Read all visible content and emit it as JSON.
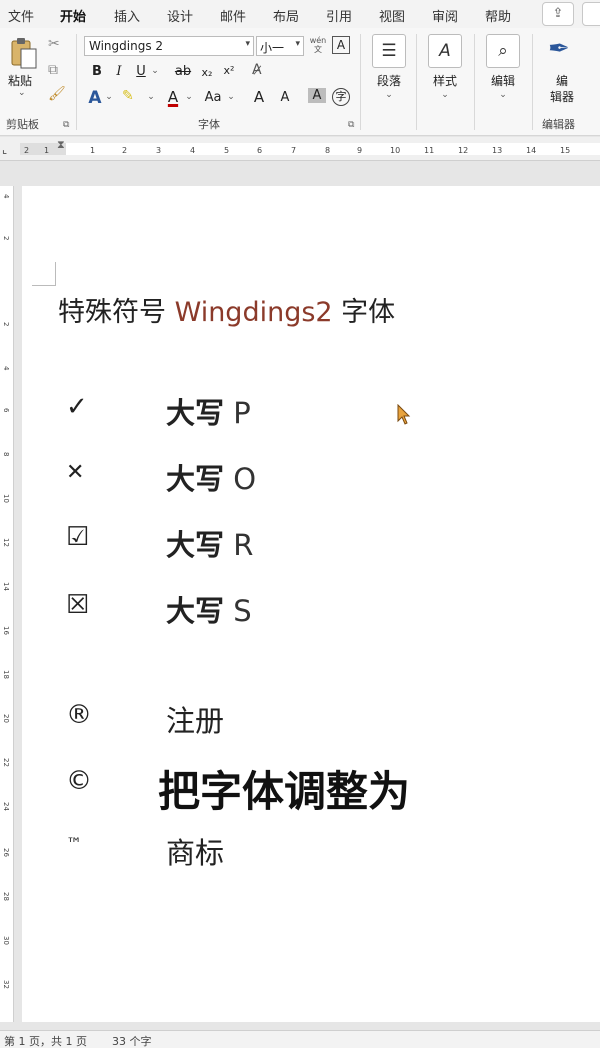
{
  "menu": {
    "tabs": [
      {
        "label": "文件"
      },
      {
        "label": "开始"
      },
      {
        "label": "插入"
      },
      {
        "label": "设计"
      },
      {
        "label": "邮件"
      },
      {
        "label": "布局"
      },
      {
        "label": "引用"
      },
      {
        "label": "视图"
      },
      {
        "label": "审阅"
      },
      {
        "label": "帮助"
      }
    ],
    "active_tab": "开始"
  },
  "ribbon": {
    "clipboard": {
      "paste_label": "粘贴",
      "group_label": "剪贴板"
    },
    "font": {
      "font_name": "Wingdings 2",
      "font_size": "小一",
      "wen_label_top": "wén",
      "wen_label_bottom": "文",
      "box_a": "A",
      "bold": "B",
      "italic": "I",
      "underline": "U",
      "strike": "ab",
      "subscript": "x₂",
      "superscript": "x²",
      "font_color": "A",
      "grow": "A",
      "shrink": "A",
      "aa": "Aa",
      "char_shading": "A",
      "enclose": "字",
      "group_label": "字体"
    },
    "paragraph": {
      "label": "段落"
    },
    "styles": {
      "label": "样式"
    },
    "editing": {
      "label": "编辑"
    },
    "editor": {
      "label_line1": "编",
      "label_line2": "辑器",
      "group_label": "编辑器"
    }
  },
  "ruler": {
    "ticks": [
      "2",
      "1",
      "1",
      "2",
      "3",
      "4",
      "5",
      "6",
      "7",
      "8",
      "9",
      "10",
      "11",
      "12",
      "13",
      "14",
      "15"
    ],
    "v_ticks": [
      "4",
      "2",
      "2",
      "4",
      "6",
      "8",
      "10",
      "12",
      "14",
      "16",
      "18",
      "20",
      "22",
      "24",
      "26",
      "28",
      "30",
      "32"
    ]
  },
  "document": {
    "title_cn": "特殊符号 ",
    "title_en": "Wingdings2",
    "title_tail": " 字体",
    "rows": [
      {
        "symbol": "✓",
        "label": "大写",
        "letter": " P",
        "bold": true
      },
      {
        "symbol": "✕",
        "label": "大写",
        "letter": " O",
        "bold": true
      },
      {
        "symbol": "☑",
        "label": "大写",
        "letter": " R",
        "bold": true
      },
      {
        "symbol": "☒",
        "label": "大写",
        "letter": " S",
        "bold": true
      },
      {
        "symbol": "®",
        "label": "注册",
        "letter": "",
        "bold": false
      },
      {
        "symbol": "©",
        "label": "",
        "letter": "",
        "bold": false
      },
      {
        "symbol": "™",
        "label": "商标",
        "letter": "",
        "bold": false
      }
    ]
  },
  "overlay": {
    "subtitle": "把字体调整为"
  },
  "status": {
    "page": "第 1 页，共 1 页",
    "words": "33 个字"
  },
  "colors": {
    "accent": "#2b579a",
    "title_en": "#8b3a2a"
  }
}
